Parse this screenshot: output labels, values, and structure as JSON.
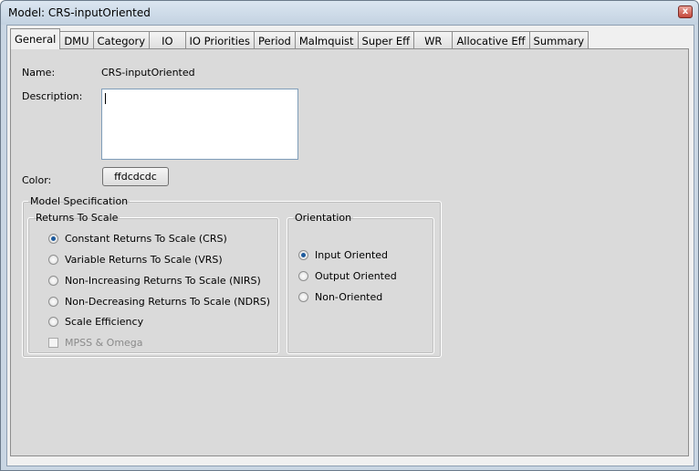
{
  "window": {
    "title": "Model: CRS-inputOriented",
    "close_glyph": "x"
  },
  "tabs": [
    "General",
    "DMU",
    "Category",
    "IO",
    "IO Priorities",
    "Period",
    "Malmquist",
    "Super Eff",
    "WR",
    "Allocative Eff",
    "Summary"
  ],
  "general": {
    "name_label": "Name:",
    "name_value": "CRS-inputOriented",
    "description_label": "Description:",
    "description_value": "",
    "color_label": "Color:",
    "color_value": "ffdcdcdc"
  },
  "model_spec": {
    "legend": "Model Specification",
    "returns": {
      "legend": "Returns To Scale",
      "options": [
        {
          "label": "Constant Returns To Scale (CRS)",
          "checked": true
        },
        {
          "label": "Variable Returns To Scale (VRS)",
          "checked": false
        },
        {
          "label": "Non-Increasing Returns To Scale (NIRS)",
          "checked": false
        },
        {
          "label": "Non-Decreasing Returns To Scale (NDRS)",
          "checked": false
        },
        {
          "label": "Scale Efficiency",
          "checked": false
        }
      ],
      "checkbox": {
        "label": "MPSS & Omega",
        "checked": false,
        "enabled": false
      }
    },
    "orientation": {
      "legend": "Orientation",
      "options": [
        {
          "label": "Input Oriented",
          "checked": true
        },
        {
          "label": "Output Oriented",
          "checked": false
        },
        {
          "label": "Non-Oriented",
          "checked": false
        }
      ]
    }
  }
}
